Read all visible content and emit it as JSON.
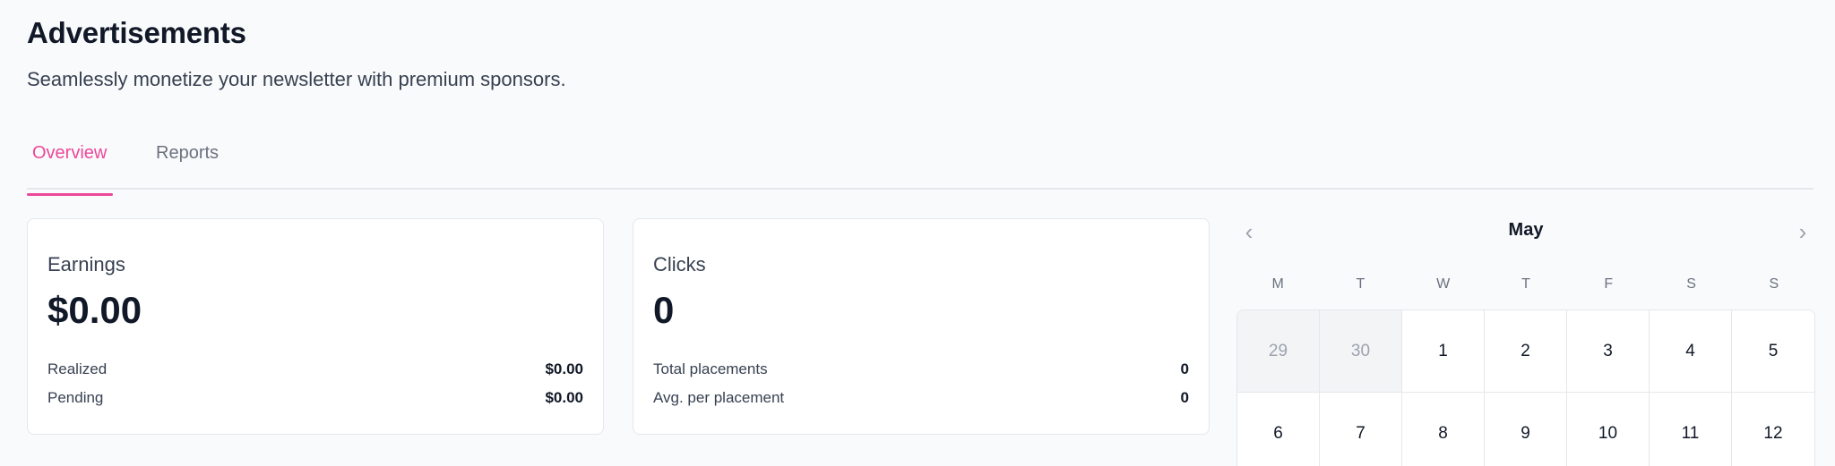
{
  "header": {
    "title": "Advertisements",
    "subtitle": "Seamlessly monetize your newsletter with premium sponsors."
  },
  "tabs": [
    {
      "label": "Overview",
      "active": true
    },
    {
      "label": "Reports",
      "active": false
    }
  ],
  "earnings": {
    "label": "Earnings",
    "value": "$0.00",
    "rows": [
      {
        "label": "Realized",
        "value": "$0.00"
      },
      {
        "label": "Pending",
        "value": "$0.00"
      }
    ]
  },
  "clicks": {
    "label": "Clicks",
    "value": "0",
    "rows": [
      {
        "label": "Total placements",
        "value": "0"
      },
      {
        "label": "Avg. per placement",
        "value": "0"
      }
    ]
  },
  "calendar": {
    "month": "May",
    "prev_icon": "chevron-left-icon",
    "next_icon": "chevron-right-icon",
    "weekdays": [
      "M",
      "T",
      "W",
      "T",
      "F",
      "S",
      "S"
    ],
    "days": [
      {
        "label": "29",
        "outside": true
      },
      {
        "label": "30",
        "outside": true
      },
      {
        "label": "1",
        "outside": false
      },
      {
        "label": "2",
        "outside": false
      },
      {
        "label": "3",
        "outside": false
      },
      {
        "label": "4",
        "outside": false
      },
      {
        "label": "5",
        "outside": false
      },
      {
        "label": "6",
        "outside": false
      },
      {
        "label": "7",
        "outside": false
      },
      {
        "label": "8",
        "outside": false
      },
      {
        "label": "9",
        "outside": false
      },
      {
        "label": "10",
        "outside": false
      },
      {
        "label": "11",
        "outside": false
      },
      {
        "label": "12",
        "outside": false
      }
    ]
  },
  "colors": {
    "accent": "#ec4899",
    "background": "#f9fafb",
    "card": "#ffffff",
    "border": "#e5e7eb"
  }
}
